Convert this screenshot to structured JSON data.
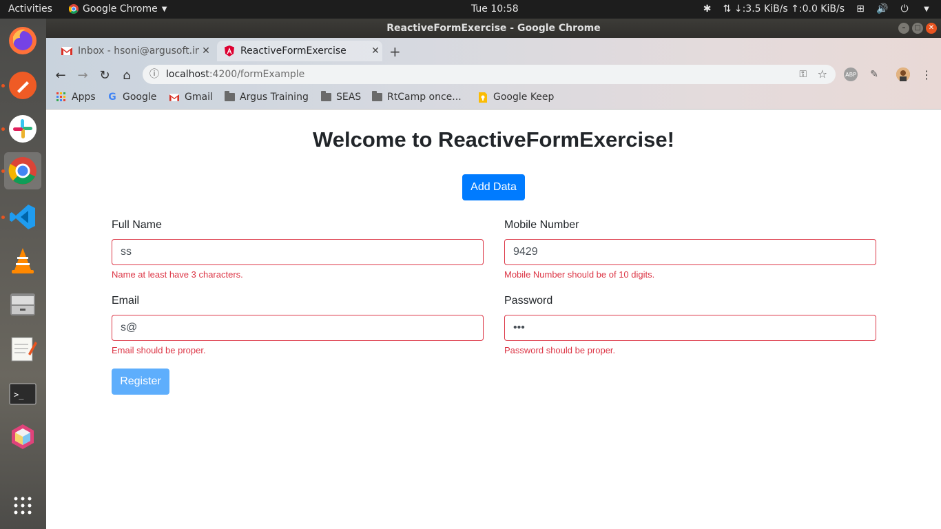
{
  "system": {
    "activities": "Activities",
    "app_menu": "Google Chrome",
    "clock": "Tue 10:58",
    "net_speed": "↓:3.5 KiB/s ↑:0.0 KiB/s"
  },
  "dock": {
    "items": [
      "firefox-icon",
      "postman-icon",
      "slack-icon",
      "chrome-icon",
      "vscode-icon",
      "vlc-icon",
      "files-icon",
      "text-editor-icon",
      "terminal-icon",
      "box-icon"
    ]
  },
  "window": {
    "title": "ReactiveFormExercise - Google Chrome"
  },
  "tabs": [
    {
      "label": "Inbox - hsoni@argusoft.in",
      "close": "✕"
    },
    {
      "label": "ReactiveFormExercise",
      "close": "✕"
    }
  ],
  "new_tab": "+",
  "address": {
    "host": "localhost",
    "path": ":4200/formExample"
  },
  "bookmarks": [
    "Apps",
    "Google",
    "Gmail",
    "Argus Training",
    "SEAS",
    "RtCamp once...",
    "Google Keep"
  ],
  "page": {
    "heading": "Welcome to ReactiveFormExercise!",
    "add_button": "Add Data",
    "fields": {
      "full_name": {
        "label": "Full Name",
        "value": "ss",
        "error": "Name at least have 3 characters."
      },
      "mobile": {
        "label": "Mobile Number",
        "value": "9429",
        "error": "Mobile Number should be of 10 digits."
      },
      "email": {
        "label": "Email",
        "value": "s@",
        "error": "Email should be proper."
      },
      "password": {
        "label": "Password",
        "value": "•••",
        "error": "Password should be proper."
      }
    },
    "register_button": "Register"
  },
  "colors": {
    "primary": "#007bff",
    "primary_disabled": "#5eaefc",
    "error": "#dc3545",
    "ubuntu_orange": "#e95420"
  }
}
